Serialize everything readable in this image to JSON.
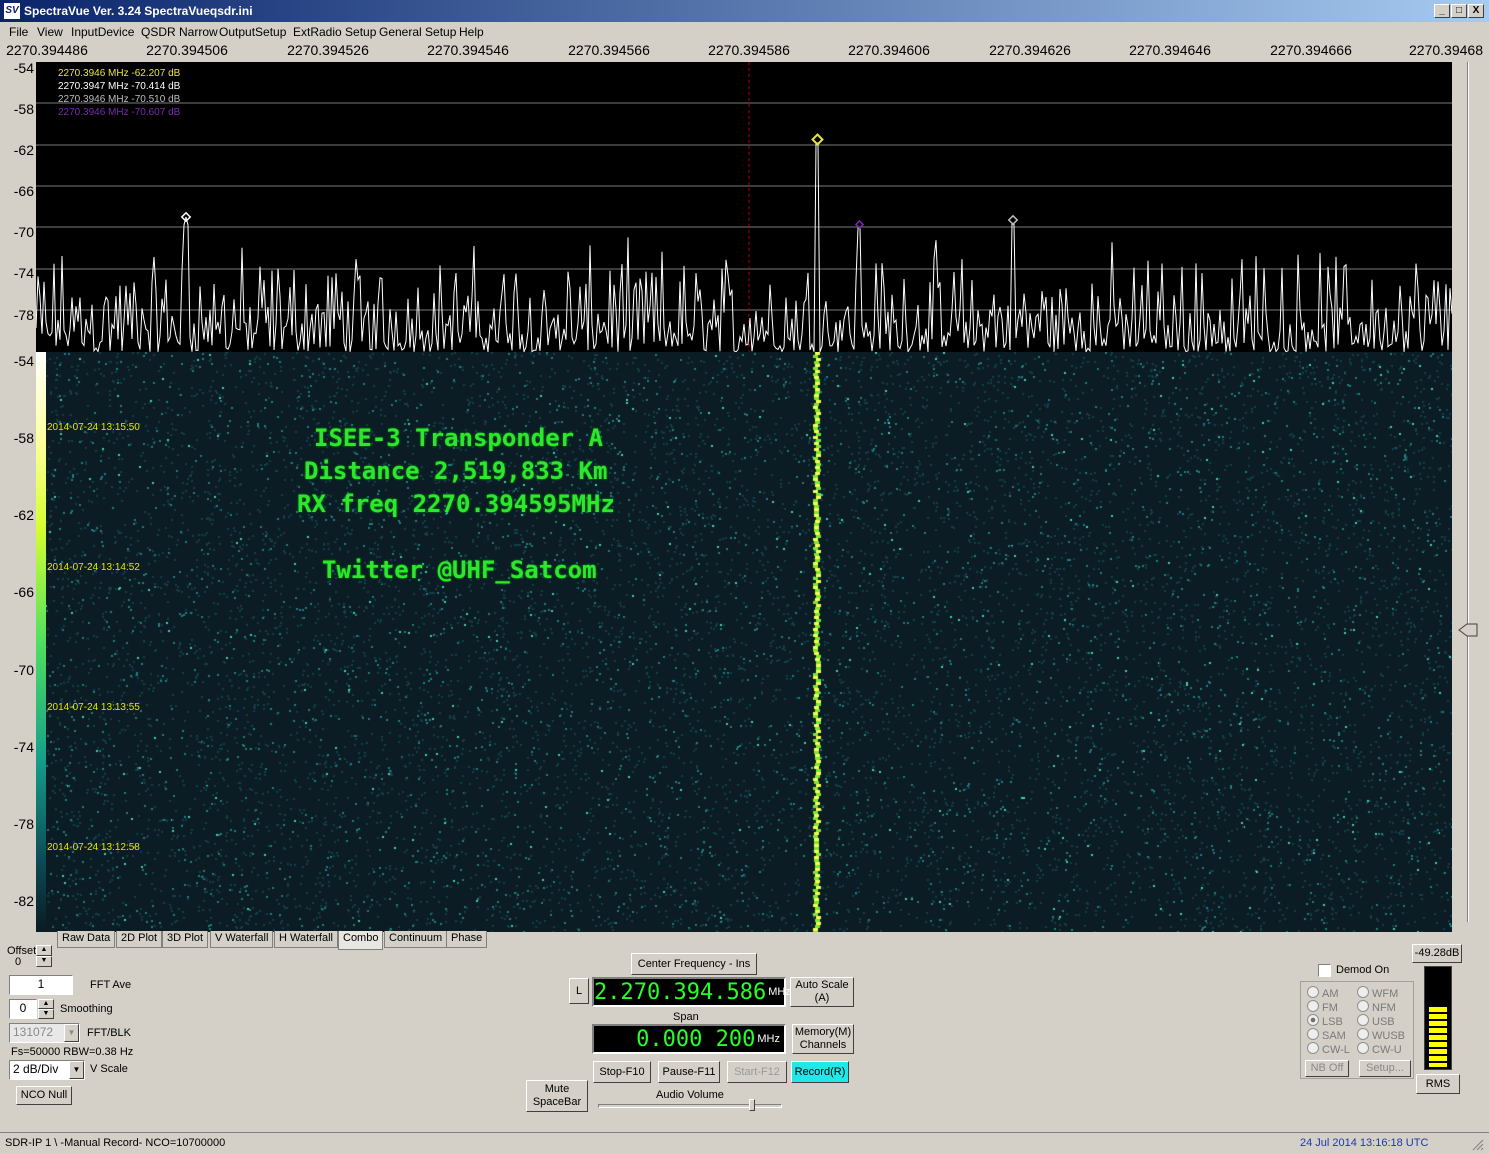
{
  "window": {
    "title": "SpectraVue Ver. 3.24  SpectraVueqsdr.ini",
    "logo": "SV",
    "minimize": "_",
    "maximize": "□",
    "close": "X"
  },
  "menu": [
    "File",
    "View",
    "InputDevice",
    "QSDR Narrow",
    "OutputSetup",
    "ExtRadio Setup",
    "General Setup",
    "Help"
  ],
  "freq_axis": [
    "2270.394486",
    "2270.394506",
    "2270.394526",
    "2270.394546",
    "2270.394566",
    "2270.394586",
    "2270.394606",
    "2270.394626",
    "2270.394646",
    "2270.394666",
    "2270.39468"
  ],
  "spectrum": {
    "y_labels": [
      "-54",
      "-58",
      "-62",
      "-66",
      "-70",
      "-74",
      "-78"
    ],
    "markers": [
      {
        "text": "2270.3946 MHz  -62.207 dB",
        "color": "#e6e640"
      },
      {
        "text": "2270.3947 MHz  -70.414 dB",
        "color": "#ffffff"
      },
      {
        "text": "2270.3946 MHz  -70.510 dB",
        "color": "#bdbdbd"
      },
      {
        "text": "2270.3946 MHz  -70.607 dB",
        "color": "#7a2ab0"
      }
    ]
  },
  "waterfall": {
    "y_labels": [
      "-54",
      "-58",
      "-62",
      "-66",
      "-70",
      "-74",
      "-78",
      "-82"
    ],
    "timestamps": [
      "2014-07-24 13:15:50",
      "2014-07-24 13:14:52",
      "2014-07-24 13:13:55",
      "2014-07-24 13:12:58"
    ],
    "overlay_lines": [
      "ISEE-3 Transponder A",
      "Distance 2,519,833 Km",
      "RX freq 2270.394595MHz",
      "",
      "Twitter @UHF_Satcom"
    ]
  },
  "tabs": [
    "Raw Data",
    "2D Plot",
    "3D Plot",
    "V Waterfall",
    "H Waterfall",
    "Combo",
    "Continuum",
    "Phase"
  ],
  "active_tab": "Combo",
  "left_controls": {
    "offset_label": "Offset",
    "offset_value": "0",
    "fft_ave_value": "1",
    "fft_ave_label": "FFT Ave",
    "smoothing_value": "0",
    "smoothing_label": "Smoothing",
    "fft_blk_value": "131072",
    "fft_blk_label": "FFT/BLK",
    "fs_info": "Fs=50000 RBW=0.38 Hz",
    "vscale_value": "2 dB/Div",
    "vscale_label": "V Scale",
    "nco_null": "NCO Null"
  },
  "center_controls": {
    "center_freq_button": "Center Frequency - Ins",
    "l_button": "L",
    "frequency": "2.270.394.586",
    "freq_unit": "MHz",
    "auto_scale": "Auto Scale (A)",
    "span_label": "Span",
    "span_value": "0.000 200",
    "span_unit": "MHz",
    "memory": "Memory(M) Channels",
    "mute": "Mute SpaceBar",
    "stop": "Stop-F10",
    "pause": "Pause-F11",
    "start": "Start-F12",
    "record": "Record(R)",
    "audio_volume": "Audio Volume",
    "audio_volume_level": 0.85
  },
  "demod": {
    "demod_on": "Demod On",
    "modes_left": [
      "AM",
      "FM",
      "LSB",
      "SAM",
      "CW-L"
    ],
    "modes_right": [
      "WFM",
      "NFM",
      "USB",
      "WUSB",
      "CW-U"
    ],
    "selected": "LSB",
    "nb_off": "NB Off",
    "setup": "Setup..."
  },
  "meter": {
    "value": "-49.28dB",
    "rms": "RMS",
    "level": 0.6
  },
  "status": {
    "left": "SDR-IP 1  \\ -Manual Record-   NCO=10700000",
    "right": "24 Jul 2014  13:16:18 UTC"
  }
}
